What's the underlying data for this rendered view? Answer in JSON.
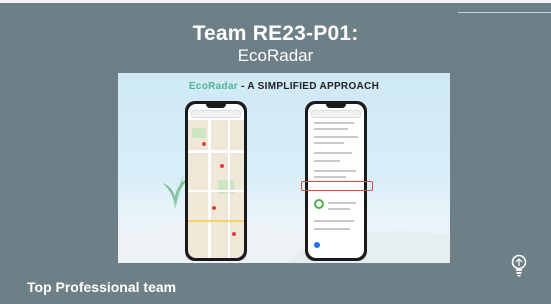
{
  "header": {
    "title_line1": "Team RE23-P01:",
    "title_line2": "EcoRadar"
  },
  "slide": {
    "brand": "EcoRadar",
    "subtitle": " - A SIMPLIFIED APPROACH"
  },
  "footer": {
    "label": "Top Professional team"
  },
  "colors": {
    "background": "#6e8087",
    "brand_green": "#54b48c",
    "highlight_red": "#d94a3f"
  },
  "icons": [
    "lightbulb-logo-icon",
    "plant-icon",
    "phone-mockup-map",
    "phone-mockup-results"
  ]
}
